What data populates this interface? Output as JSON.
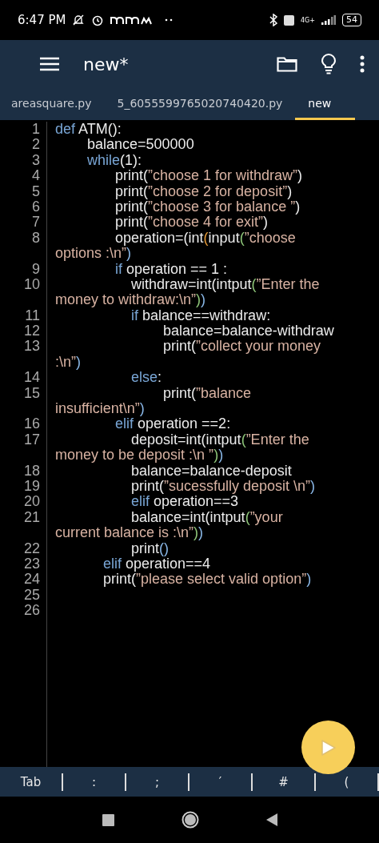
{
  "status_bar": {
    "time": "6:47 PM",
    "network": "4G+",
    "battery": "54"
  },
  "app_bar": {
    "title": "new*"
  },
  "tabs": [
    {
      "label": "areasquare.py",
      "selected": false
    },
    {
      "label": "5_6055599765020740420.py",
      "selected": false
    },
    {
      "label": "new",
      "selected": true
    }
  ],
  "code_rows": [
    {
      "number": "1",
      "tokens": [
        {
          "kind": "kw",
          "text": "def"
        },
        {
          "kind": "plain",
          "text": " ATM():"
        }
      ]
    },
    {
      "number": "2",
      "tokens": [
        {
          "kind": "plain",
          "text": "        balance=500000"
        }
      ]
    },
    {
      "number": "3",
      "tokens": [
        {
          "kind": "kw",
          "text": "        while"
        },
        {
          "kind": "plain",
          "text": "(1):"
        }
      ]
    },
    {
      "number": "4",
      "tokens": [
        {
          "kind": "plain",
          "text": "               print("
        },
        {
          "kind": "str",
          "text": "”choose 1 for withdraw”"
        },
        {
          "kind": "plain",
          "text": ")"
        }
      ]
    },
    {
      "number": "5",
      "tokens": [
        {
          "kind": "plain",
          "text": "               print("
        },
        {
          "kind": "str",
          "text": "”choose 2 for deposit”"
        },
        {
          "kind": "plain",
          "text": ")"
        }
      ]
    },
    {
      "number": "6",
      "tokens": [
        {
          "kind": "plain",
          "text": "               print("
        },
        {
          "kind": "str",
          "text": "”choose 3 for balance ”"
        },
        {
          "kind": "plain",
          "text": ")"
        }
      ]
    },
    {
      "number": "7",
      "tokens": [
        {
          "kind": "plain",
          "text": "               print("
        },
        {
          "kind": "str",
          "text": "”choose 4 for exit”"
        },
        {
          "kind": "plain",
          "text": ")"
        }
      ]
    },
    {
      "number": "8",
      "tokens": [
        {
          "kind": "plain",
          "text": "               operation=(int"
        },
        {
          "kind": "paren_orange",
          "text": "("
        },
        {
          "kind": "plain",
          "text": "input"
        },
        {
          "kind": "paren_green",
          "text": "("
        },
        {
          "kind": "str",
          "text": "”choose"
        }
      ]
    },
    {
      "tokens": [
        {
          "kind": "str",
          "text": "options :\\n”"
        },
        {
          "kind": "paren_blue",
          "text": ")"
        }
      ]
    },
    {
      "number": "9",
      "tokens": [
        {
          "kind": "kw",
          "text": "               if"
        },
        {
          "kind": "plain",
          "text": " operation == 1 :"
        }
      ]
    },
    {
      "number": "10",
      "tokens": [
        {
          "kind": "plain",
          "text": "                   withdraw=int(intput"
        },
        {
          "kind": "paren_green",
          "text": "("
        },
        {
          "kind": "str",
          "text": "”Enter the"
        }
      ]
    },
    {
      "tokens": [
        {
          "kind": "str",
          "text": "money to withdraw:\\n”"
        },
        {
          "kind": "paren_green",
          "text": ")"
        },
        {
          "kind": "paren_blue",
          "text": ")"
        }
      ]
    },
    {
      "number": "11",
      "tokens": [
        {
          "kind": "kw",
          "text": "                   if"
        },
        {
          "kind": "plain",
          "text": " balance==withdraw:"
        }
      ]
    },
    {
      "number": "12",
      "tokens": [
        {
          "kind": "plain",
          "text": "                           balance=balance-withdraw"
        }
      ]
    },
    {
      "number": "13",
      "tokens": [
        {
          "kind": "plain",
          "text": "                           print("
        },
        {
          "kind": "str",
          "text": "”collect your money"
        }
      ]
    },
    {
      "tokens": [
        {
          "kind": "str",
          "text": ":\\n”"
        },
        {
          "kind": "paren_blue",
          "text": ")"
        }
      ]
    },
    {
      "number": "14",
      "tokens": [
        {
          "kind": "kw",
          "text": "                   else"
        },
        {
          "kind": "plain",
          "text": ":"
        }
      ]
    },
    {
      "number": "15",
      "tokens": [
        {
          "kind": "plain",
          "text": "                           print("
        },
        {
          "kind": "str",
          "text": "”balance"
        }
      ]
    },
    {
      "tokens": [
        {
          "kind": "str",
          "text": "insufficient\\n”"
        },
        {
          "kind": "paren_blue",
          "text": ")"
        }
      ]
    },
    {
      "number": "16",
      "tokens": [
        {
          "kind": "kw",
          "text": "               elif"
        },
        {
          "kind": "plain",
          "text": " operation ==2:"
        }
      ]
    },
    {
      "number": "17",
      "tokens": [
        {
          "kind": "plain",
          "text": "                   deposit=int(intput"
        },
        {
          "kind": "paren_green",
          "text": "("
        },
        {
          "kind": "str",
          "text": "”Enter the"
        }
      ]
    },
    {
      "tokens": [
        {
          "kind": "str",
          "text": "money to be deposit :\\n ”"
        },
        {
          "kind": "paren_green",
          "text": ")"
        },
        {
          "kind": "paren_blue",
          "text": ")"
        }
      ]
    },
    {
      "number": "18",
      "tokens": [
        {
          "kind": "plain",
          "text": "                   balance=balance-deposit"
        }
      ]
    },
    {
      "number": "19",
      "tokens": [
        {
          "kind": "plain",
          "text": "                   print("
        },
        {
          "kind": "str",
          "text": "”sucessfully deposit \\n”"
        },
        {
          "kind": "paren_blue",
          "text": ")"
        }
      ]
    },
    {
      "number": "20",
      "tokens": [
        {
          "kind": "kw",
          "text": "                   elif"
        },
        {
          "kind": "plain",
          "text": " operation==3"
        }
      ]
    },
    {
      "number": "21",
      "tokens": [
        {
          "kind": "plain",
          "text": "                   balance=int(intput"
        },
        {
          "kind": "paren_green",
          "text": "("
        },
        {
          "kind": "str",
          "text": "”your"
        }
      ]
    },
    {
      "tokens": [
        {
          "kind": "str",
          "text": "current balance is :\\n”"
        },
        {
          "kind": "paren_green",
          "text": ")"
        },
        {
          "kind": "paren_blue",
          "text": ")"
        }
      ]
    },
    {
      "number": "22",
      "tokens": [
        {
          "kind": "plain",
          "text": "                   print"
        },
        {
          "kind": "paren_blue",
          "text": "()"
        }
      ]
    },
    {
      "number": "23",
      "tokens": [
        {
          "kind": "kw",
          "text": "            elif"
        },
        {
          "kind": "plain",
          "text": " operation==4"
        }
      ]
    },
    {
      "number": "24",
      "tokens": [
        {
          "kind": "plain",
          "text": "            print("
        },
        {
          "kind": "str",
          "text": "”please select valid option”"
        },
        {
          "kind": "paren_blue",
          "text": ")"
        }
      ]
    },
    {
      "number": "25",
      "tokens": []
    },
    {
      "number": "26",
      "tokens": []
    }
  ],
  "key_bar": [
    "Tab",
    ":",
    ";",
    "′",
    "#",
    "("
  ]
}
